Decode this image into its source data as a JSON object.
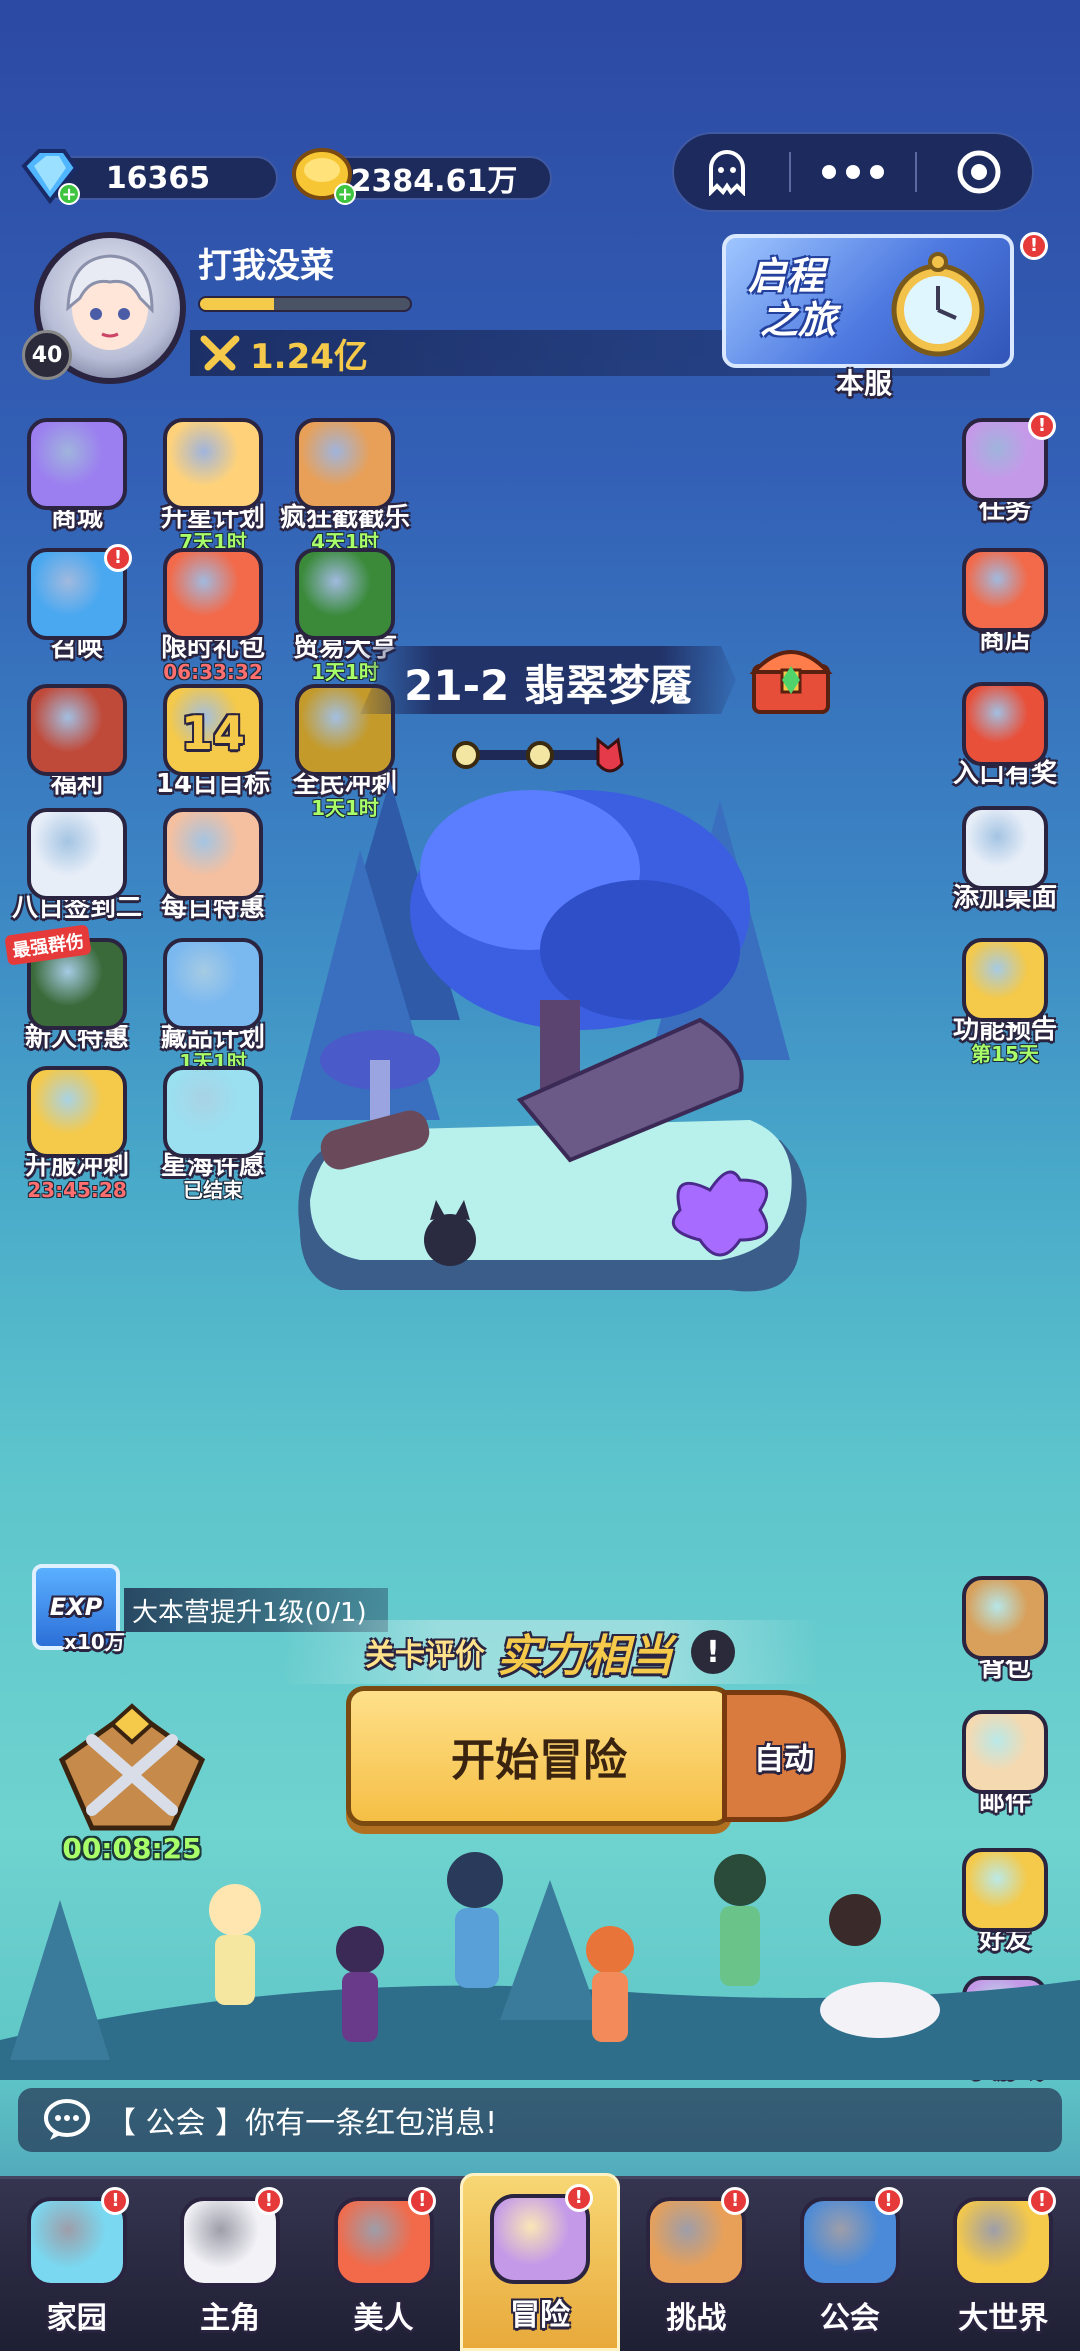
{
  "currency": {
    "gems": "16365",
    "gold": "2384.61万"
  },
  "player": {
    "name": "打我没菜",
    "level": "40",
    "power": "1.24亿",
    "exp_fraction": 0.35
  },
  "event_banner": {
    "title_line1": "启程",
    "title_line2": "之旅",
    "caption": "本服"
  },
  "left_icons": [
    {
      "label": "商城",
      "timer": "",
      "badge": ""
    },
    {
      "label": "升星计划",
      "timer": "7天1时",
      "badge": ""
    },
    {
      "label": "疯狂戳戳乐",
      "timer": "4天1时",
      "badge": ""
    },
    {
      "label": "召唤",
      "timer": "",
      "badge": "!"
    },
    {
      "label": "限时礼包",
      "timer": "06:33:32",
      "badge": ""
    },
    {
      "label": "贸易大亨",
      "timer": "1天1时",
      "badge": ""
    },
    {
      "label": "福利",
      "timer": "",
      "badge": ""
    },
    {
      "label": "14日目标",
      "timer": "",
      "badge": "",
      "art_text": "14"
    },
    {
      "label": "全民冲刺",
      "timer": "1天1时",
      "badge": ""
    },
    {
      "label": "八日签到二",
      "timer": "",
      "badge": ""
    },
    {
      "label": "每日特惠",
      "timer": "",
      "badge": ""
    },
    {
      "label": "新人特惠",
      "timer": "",
      "badge": "",
      "tag": "最强群伤"
    },
    {
      "label": "藏品计划",
      "timer": "1天1时",
      "badge": ""
    },
    {
      "label": "开服冲刺",
      "timer": "23:45:28",
      "badge": ""
    },
    {
      "label": "星海许愿",
      "timer": "已结束",
      "badge": ""
    }
  ],
  "right_icons": [
    {
      "label": "任务",
      "badge": "!"
    },
    {
      "label": "商店",
      "badge": ""
    },
    {
      "label": "入口有奖",
      "badge": ""
    },
    {
      "label": "添加桌面",
      "badge": ""
    },
    {
      "label": "功能预告",
      "timer": "第15天",
      "badge": ""
    },
    {
      "label": "背包",
      "badge": ""
    },
    {
      "label": "邮件",
      "badge": ""
    },
    {
      "label": "好友",
      "badge": ""
    },
    {
      "label": "小游戏",
      "badge": ""
    }
  ],
  "stage": {
    "title": "21-2 翡翠梦魇",
    "progress_nodes": 3
  },
  "task": {
    "exp_label": "EXP",
    "exp_mult": "x10万",
    "text": "大本营提升1级(0/1)"
  },
  "rating": {
    "label": "关卡评价",
    "value": "实力相当",
    "info": "!"
  },
  "battle": {
    "start": "开始冒险",
    "auto": "自动",
    "chest_timer": "00:08:25"
  },
  "chat": {
    "channel": "【 公会 】",
    "message": "你有一条红包消息!"
  },
  "nav": [
    {
      "label": "家园",
      "badge": "!"
    },
    {
      "label": "主角",
      "badge": "!"
    },
    {
      "label": "美人",
      "badge": "!"
    },
    {
      "label": "冒险",
      "badge": "!",
      "active": true
    },
    {
      "label": "挑战",
      "badge": "!"
    },
    {
      "label": "公会",
      "badge": "!"
    },
    {
      "label": "大世界",
      "badge": "!"
    }
  ],
  "colors": {
    "accent_gold": "#f5c949",
    "timer_green": "#a9ff6a",
    "timer_red": "#ff6f6f",
    "badge_red": "#e63a3a"
  }
}
